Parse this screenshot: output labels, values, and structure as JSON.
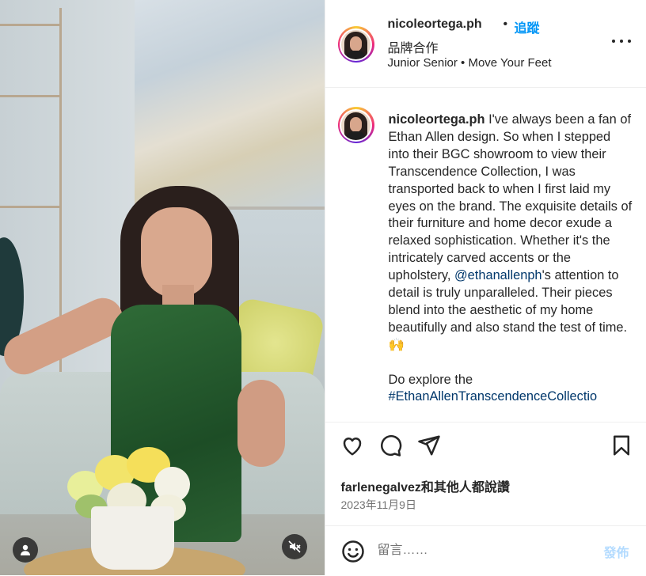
{
  "header": {
    "username": "nicoleortega.ph",
    "dot": "•",
    "follow_label": "追蹤",
    "partnership_label": "品牌合作",
    "audio": "Junior Senior • Move Your Feet"
  },
  "caption": {
    "username": "nicoleortega.ph",
    "text_before_mention": "I've always been a fan of Ethan Allen design. So when I stepped into their BGC showroom to view their Transcendence Collection, I was transported back to when I first laid my eyes on the brand. The exquisite details of their furniture and home decor exude a relaxed sophistication. Whether it's the intricately carved accents or the upholstery,",
    "mention": "@ethanallenph",
    "text_after_mention": "'s attention to detail is truly unparalleled. Their pieces blend into the aesthetic of my home beautifully and also stand the test of time. 🙌",
    "second_paragraph": "Do explore the",
    "hashtag": "#EthanAllenTranscendenceCollectio"
  },
  "likes": {
    "username": "farlenegalvez",
    "suffix": "和其他人都說讚"
  },
  "date": "2023年11月9日",
  "comment": {
    "placeholder": "留言……",
    "post_label": "發佈"
  },
  "icons": {
    "like": "heart-icon",
    "comment": "comment-icon",
    "share": "share-icon",
    "save": "bookmark-icon",
    "more": "more-options-icon",
    "emoji": "emoji-icon",
    "tagged_users": "user-icon",
    "mute": "audio-muted-icon"
  },
  "colors": {
    "link_blue": "#0095f6",
    "mention_blue": "#00376b",
    "secondary_text": "#737373",
    "disabled_post": "#b3dbff"
  }
}
